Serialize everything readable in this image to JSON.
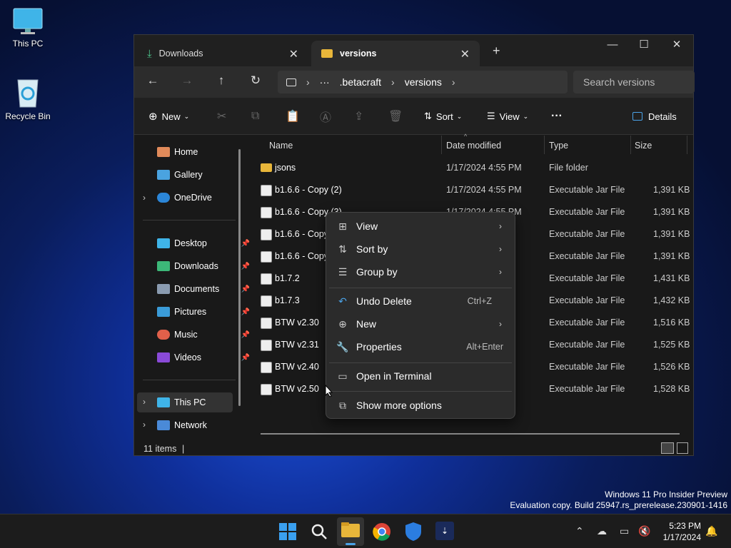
{
  "desktop": {
    "icons": [
      {
        "label": "This PC"
      },
      {
        "label": "Recycle Bin"
      }
    ]
  },
  "window": {
    "tabs": [
      {
        "label": "Downloads",
        "active": false
      },
      {
        "label": "versions",
        "active": true
      }
    ],
    "new_tab": "+",
    "controls": {
      "minimize": "—",
      "maximize": "☐",
      "close": "✕"
    },
    "nav": {
      "back": "←",
      "forward": "→",
      "up": "↑",
      "refresh": "↻"
    },
    "address": {
      "more": "···",
      "separator": "›",
      "segments": [
        ".betacraft",
        "versions"
      ]
    },
    "search": {
      "placeholder": "Search versions"
    },
    "commands": {
      "new": "New",
      "sort": "Sort",
      "view": "View",
      "more": "···",
      "details": "Details"
    },
    "sidebar": {
      "home": "Home",
      "gallery": "Gallery",
      "onedrive": "OneDrive",
      "desktop": "Desktop",
      "downloads": "Downloads",
      "documents": "Documents",
      "pictures": "Pictures",
      "music": "Music",
      "videos": "Videos",
      "thispc": "This PC",
      "network": "Network"
    },
    "columns": {
      "name": "Name",
      "date": "Date modified",
      "type": "Type",
      "size": "Size"
    },
    "files": [
      {
        "name": "jsons",
        "date": "1/17/2024 4:55 PM",
        "type": "File folder",
        "size": "",
        "kind": "folder"
      },
      {
        "name": "b1.6.6 - Copy (2)",
        "date": "1/17/2024 4:55 PM",
        "type": "Executable Jar File",
        "size": "1,391 KB",
        "kind": "jar"
      },
      {
        "name": "b1.6.6 - Copy (3)",
        "date": "1/17/2024 4:55 PM",
        "type": "Executable Jar File",
        "size": "1,391 KB",
        "kind": "jar"
      },
      {
        "name": "b1.6.6 - Copy",
        "date": "",
        "type": "Executable Jar File",
        "size": "1,391 KB",
        "kind": "jar"
      },
      {
        "name": "b1.6.6 - Copy",
        "date": "",
        "type": "Executable Jar File",
        "size": "1,391 KB",
        "kind": "jar"
      },
      {
        "name": "b1.7.2",
        "date": "",
        "type": "Executable Jar File",
        "size": "1,431 KB",
        "kind": "jar"
      },
      {
        "name": "b1.7.3",
        "date": "",
        "type": "Executable Jar File",
        "size": "1,432 KB",
        "kind": "jar"
      },
      {
        "name": "BTW v2.30",
        "date": "",
        "type": "Executable Jar File",
        "size": "1,516 KB",
        "kind": "jar"
      },
      {
        "name": "BTW v2.31",
        "date": "",
        "type": "Executable Jar File",
        "size": "1,525 KB",
        "kind": "jar"
      },
      {
        "name": "BTW v2.40",
        "date": "",
        "type": "Executable Jar File",
        "size": "1,526 KB",
        "kind": "jar"
      },
      {
        "name": "BTW v2.50",
        "date": "",
        "type": "Executable Jar File",
        "size": "1,528 KB",
        "kind": "jar"
      }
    ],
    "status": {
      "count": "11 items"
    }
  },
  "context_menu": {
    "items": [
      {
        "icon": "view-icon",
        "label": "View",
        "shortcut": "",
        "submenu": true
      },
      {
        "icon": "sort-icon",
        "label": "Sort by",
        "shortcut": "",
        "submenu": true
      },
      {
        "icon": "group-icon",
        "label": "Group by",
        "shortcut": "",
        "submenu": true
      },
      {
        "icon": "undo-icon",
        "label": "Undo Delete",
        "shortcut": "Ctrl+Z",
        "submenu": false
      },
      {
        "icon": "new-icon",
        "label": "New",
        "shortcut": "",
        "submenu": true
      },
      {
        "icon": "properties-icon",
        "label": "Properties",
        "shortcut": "Alt+Enter",
        "submenu": false
      },
      {
        "icon": "terminal-icon",
        "label": "Open in Terminal",
        "shortcut": "",
        "submenu": false
      },
      {
        "icon": "more-options-icon",
        "label": "Show more options",
        "shortcut": "",
        "submenu": false
      }
    ]
  },
  "watermark": {
    "line1": "Windows 11 Pro Insider Preview",
    "line2": "Evaluation copy. Build 25947.rs_prerelease.230901-1416"
  },
  "taskbar": {
    "clock": {
      "time": "5:23 PM",
      "date": "1/17/2024"
    }
  },
  "colors": {
    "accent": "#0078d4",
    "folder": "#e8b63a"
  }
}
